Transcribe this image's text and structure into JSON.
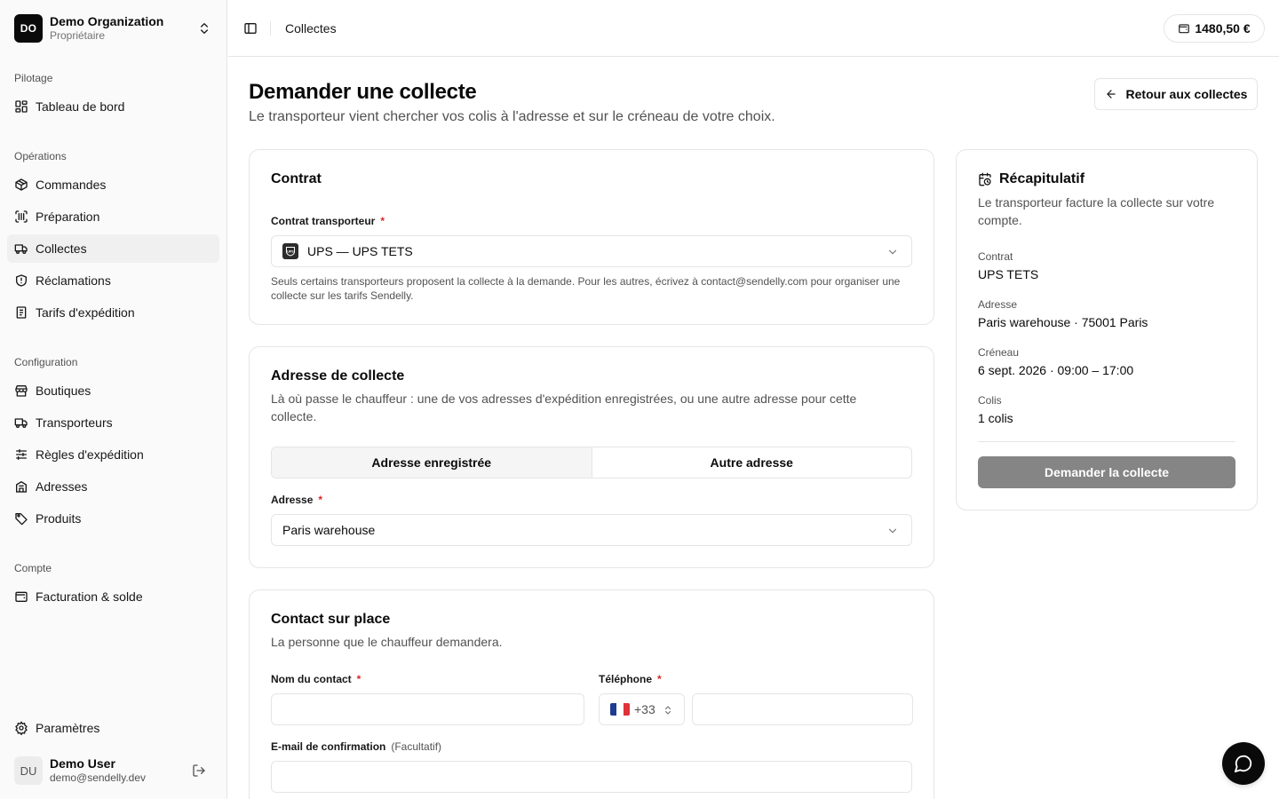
{
  "org": {
    "initials": "DO",
    "name": "Demo Organization",
    "role": "Propriétaire"
  },
  "sidebar": {
    "groups": [
      {
        "label": "Pilotage"
      },
      {
        "label": "Opérations"
      },
      {
        "label": "Configuration"
      },
      {
        "label": "Compte"
      }
    ],
    "items": [
      {
        "label": "Tableau de bord",
        "icon": "dashboard-icon"
      },
      {
        "label": "Commandes",
        "icon": "package-icon"
      },
      {
        "label": "Préparation",
        "icon": "scan-barcode-icon"
      },
      {
        "label": "Collectes",
        "icon": "truck-icon",
        "active": true
      },
      {
        "label": "Réclamations",
        "icon": "shield-alert-icon"
      },
      {
        "label": "Tarifs d'expédition",
        "icon": "receipt-icon"
      },
      {
        "label": "Boutiques",
        "icon": "store-icon"
      },
      {
        "label": "Transporteurs",
        "icon": "truck-icon"
      },
      {
        "label": "Règles d'expédition",
        "icon": "sliders-icon"
      },
      {
        "label": "Adresses",
        "icon": "building-icon"
      },
      {
        "label": "Produits",
        "icon": "tag-icon"
      },
      {
        "label": "Facturation & solde",
        "icon": "wallet-icon"
      }
    ],
    "settings_label": "Paramètres"
  },
  "user": {
    "initials": "DU",
    "name": "Demo User",
    "email": "demo@sendelly.dev"
  },
  "header": {
    "breadcrumb": "Collectes",
    "balance": "1480,50 €"
  },
  "page": {
    "title": "Demander une collecte",
    "subtitle": "Le transporteur vient chercher vos colis à l'adresse et sur le créneau de votre choix.",
    "back_label": "Retour aux collectes"
  },
  "contract_card": {
    "title": "Contrat",
    "field_label": "Contrat transporteur",
    "selected": "UPS — UPS TETS",
    "logo_text": "UPS",
    "help": "Seuls certains transporteurs proposent la collecte à la demande. Pour les autres, écrivez à contact@sendelly.com pour organiser une collecte sur les tarifs Sendelly."
  },
  "address_card": {
    "title": "Adresse de collecte",
    "desc": "Là où passe le chauffeur : une de vos adresses d'expédition enregistrées, ou une autre adresse pour cette collecte.",
    "tab_saved": "Adresse enregistrée",
    "tab_other": "Autre adresse",
    "field_label": "Adresse",
    "selected": "Paris warehouse"
  },
  "contact_card": {
    "title": "Contact sur place",
    "desc": "La personne que le chauffeur demandera.",
    "name_label": "Nom du contact",
    "name_value": "",
    "phone_label": "Téléphone",
    "phone_code": "+33",
    "phone_value": "",
    "email_label": "E-mail de confirmation",
    "email_optional": "(Facultatif)",
    "email_value": ""
  },
  "required_mark": "*",
  "summary": {
    "title": "Récapitulatif",
    "desc": "Le transporteur facture la collecte sur votre compte.",
    "contract_label": "Contrat",
    "contract_value": "UPS TETS",
    "address_label": "Adresse",
    "address_value": "Paris warehouse · 75001 Paris",
    "slot_label": "Créneau",
    "slot_value": "6 sept. 2026 · 09:00 – 17:00",
    "parcels_label": "Colis",
    "parcels_value": "1 colis",
    "submit_label": "Demander la collecte"
  },
  "colors": {
    "accent": "#0a0a0a",
    "border": "#e5e5e5",
    "muted": "#525252",
    "required": "#dc2626",
    "disabled_button": "#858585"
  }
}
